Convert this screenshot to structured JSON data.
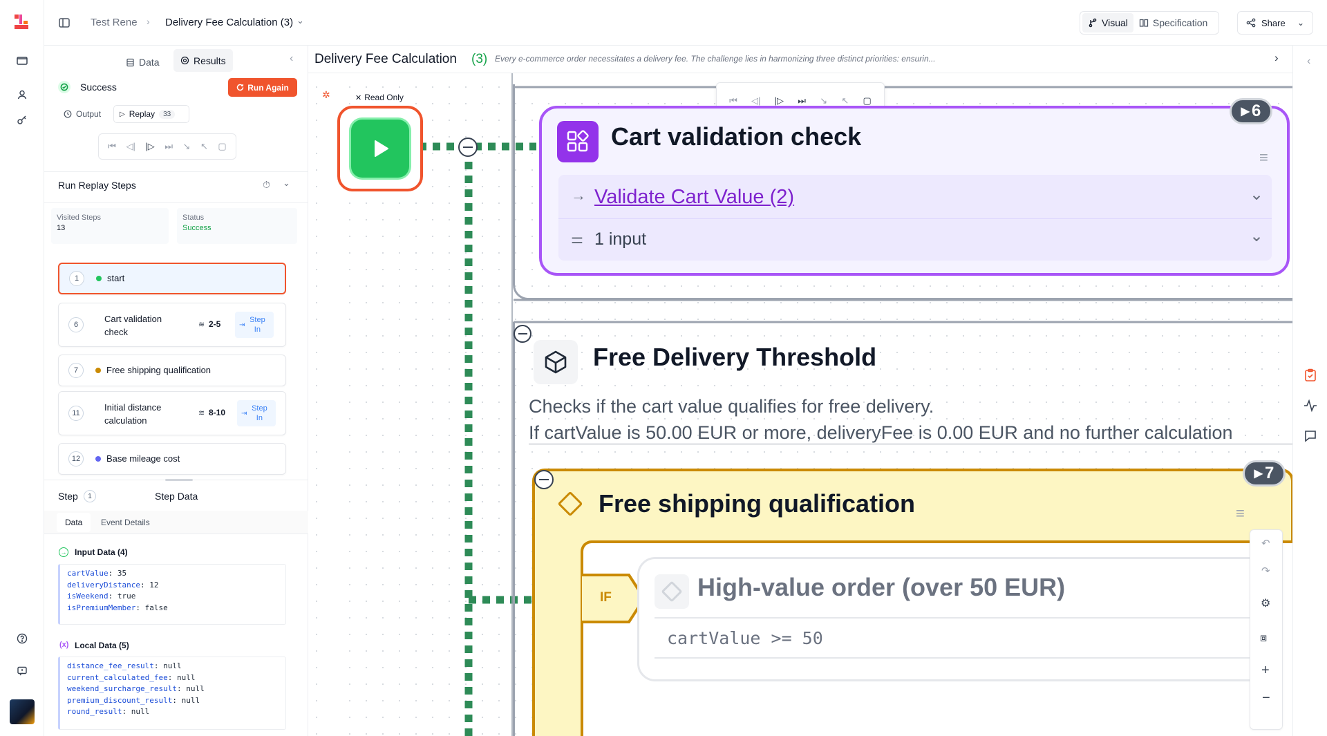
{
  "header": {
    "workspace": "Test Rene",
    "flow_title": "Delivery Fee Calculation (3)",
    "visual_label": "Visual",
    "specification_label": "Specification",
    "share_label": "Share"
  },
  "panel": {
    "tabs": {
      "data": "Data",
      "results": "Results"
    },
    "status": "Success",
    "run_again": "Run Again",
    "subtabs": {
      "output": "Output",
      "replay": "Replay",
      "replay_count": "33"
    },
    "run_replay_steps": "Run Replay Steps",
    "visited_steps_label": "Visited Steps",
    "visited_steps_value": "13",
    "status_label": "Status",
    "status_value": "Success",
    "steps": [
      {
        "num": "1",
        "label": "start",
        "dot": "#22c55e"
      },
      {
        "num": "6",
        "label": "Cart validation check",
        "range": "2-5",
        "step_in": "Step In"
      },
      {
        "num": "7",
        "label": "Free shipping qualification",
        "dot": "#ca8a04"
      },
      {
        "num": "11",
        "label": "Initial distance calculation",
        "range": "8-10",
        "step_in": "Step In"
      },
      {
        "num": "12",
        "label": "Base mileage cost",
        "dot": "#6366f1"
      }
    ],
    "step_label": "Step",
    "step_num": "1",
    "step_data_label": "Step Data",
    "data_tabs": {
      "data": "Data",
      "event_details": "Event Details"
    },
    "input_data_label": "Input Data (4)",
    "input_data": [
      {
        "key": "cartValue",
        "value": "35"
      },
      {
        "key": "deliveryDistance",
        "value": "12"
      },
      {
        "key": "isWeekend",
        "value": "true"
      },
      {
        "key": "isPremiumMember",
        "value": "false"
      }
    ],
    "local_data_label": "Local Data (5)",
    "local_data": [
      {
        "key": "distance_fee_result",
        "value": "null"
      },
      {
        "key": "current_calculated_fee",
        "value": "null"
      },
      {
        "key": "weekend_surcharge_result",
        "value": "null"
      },
      {
        "key": "premium_discount_result",
        "value": "null"
      },
      {
        "key": "round_result",
        "value": "null"
      }
    ]
  },
  "canvas": {
    "title": "Delivery Fee Calculation",
    "title_num": "(3)",
    "description": "Every e-commerce order necessitates a delivery fee. The challenge lies in harmonizing three distinct priorities: ensurin...",
    "read_only": "Read Only",
    "cart_node": {
      "title": "Cart validation check",
      "badge": "6",
      "subflow": "Validate Cart Value (2)",
      "inputs": "1 input"
    },
    "threshold_node": {
      "title": "Free Delivery Threshold",
      "desc1": "Checks if the cart value qualifies for free delivery.",
      "desc2": "If cartValue is 50.00 EUR or more, deliveryFee is 0.00 EUR and no further calculation"
    },
    "shipping_node": {
      "title": "Free shipping qualification",
      "badge": "7",
      "if_label": "IF",
      "condition_title": "High-value order (over 50 EUR)",
      "condition_expr": "cartValue >= 50"
    }
  },
  "colors": {
    "accent_red": "#f0542d",
    "success_green": "#22c55e",
    "purple": "#8b5cf6",
    "yellow_bg": "#fdf6c3",
    "yellow_border": "#ca8a04",
    "dash_green": "#2e8b57"
  }
}
